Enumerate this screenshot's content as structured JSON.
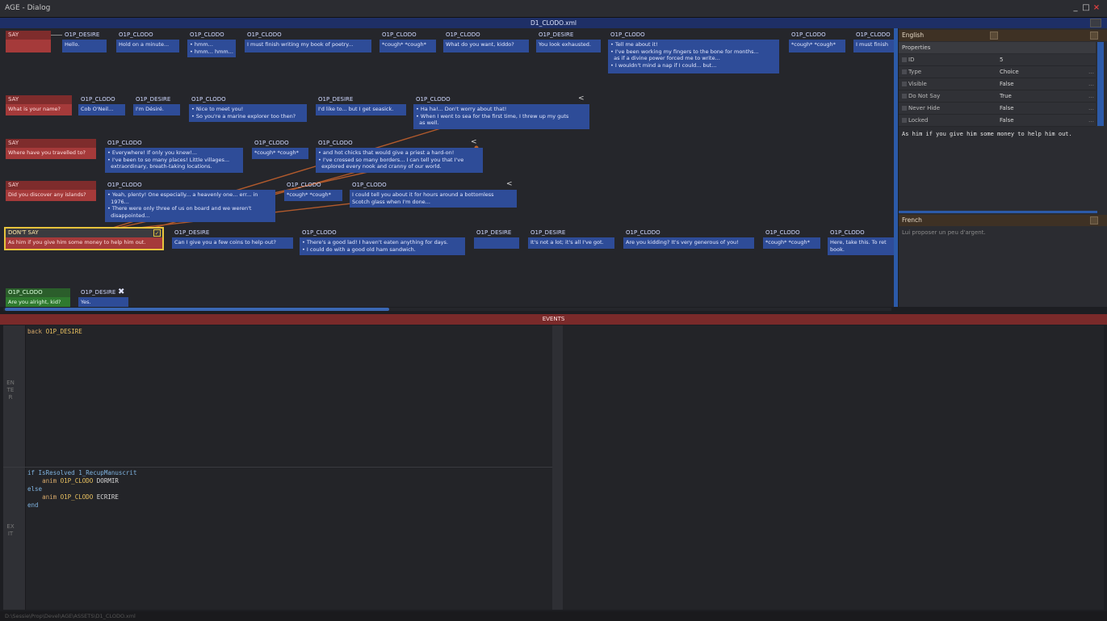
{
  "window": {
    "title": "AGE - Dialog",
    "min": "_",
    "max": "□",
    "close": "×"
  },
  "file": {
    "name": "D1_CLODO.xml"
  },
  "colors": {
    "say": "#a53a3a",
    "npc": "#2e4c98",
    "events": "#7a2a2a",
    "selected": "#e6c33c",
    "green": "#2f7a2f"
  },
  "rows": [
    {
      "say": {
        "head": "SAY",
        "body": ""
      },
      "nodes": [
        {
          "head": "O1P_DESIRE",
          "body": "Hello."
        },
        {
          "head": "O1P_CLODO",
          "body": "Hold on a minute..."
        },
        {
          "head": "O1P_CLODO",
          "body": "• hmm...\n• hmm... hmm..."
        },
        {
          "head": "O1P_CLODO",
          "body": "I must finish writing my book of poetry..."
        },
        {
          "head": "O1P_CLODO",
          "body": "*cough* *cough*"
        },
        {
          "head": "O1P_CLODO",
          "body": "What do you want, kiddo?"
        },
        {
          "head": "O1P_DESIRE",
          "body": "You look exhausted."
        },
        {
          "head": "O1P_CLODO",
          "body": "• Tell me about it!\n• I've been working my fingers to the bone for months...\n  as if a divine power forced me to write...\n• I wouldn't mind a nap if I could... but..."
        },
        {
          "head": "O1P_CLODO",
          "body": "*cough* *cough*"
        },
        {
          "head": "O1P_CLODO",
          "body": "I must finish"
        }
      ]
    },
    {
      "say": {
        "head": "SAY",
        "body": "What is your name?"
      },
      "nodes": [
        {
          "head": "O1P_CLODO",
          "body": "Cob O'Neil..."
        },
        {
          "head": "O1P_DESIRE",
          "body": "I'm Désiré."
        },
        {
          "head": "O1P_CLODO",
          "body": "• Nice to meet you!\n• So you're a marine explorer too then?"
        },
        {
          "head": "O1P_DESIRE",
          "body": "I'd like to... but I get seasick."
        },
        {
          "head": "O1P_CLODO",
          "body": "• Ha ha!... Don't worry about that!\n• When I went to sea for the first time, I threw up my guts\n  as well."
        }
      ]
    },
    {
      "say": {
        "head": "SAY",
        "body": "Where have you travelled to?"
      },
      "nodes": [
        {
          "head": "O1P_CLODO",
          "body": "• Everywhere! If only you knew!...\n• I've been to so many places! Little villages...\n  extraordinary, breath-taking locations."
        },
        {
          "head": "O1P_CLODO",
          "body": "*cough* *cough*"
        },
        {
          "head": "O1P_CLODO",
          "body": "• and hot chicks that would give a priest a hard-on!\n• I've crossed so many borders... I can tell you that I've\n  explored every nook and cranny of our world."
        }
      ]
    },
    {
      "say": {
        "head": "SAY",
        "body": "Did you discover any islands?"
      },
      "nodes": [
        {
          "head": "O1P_CLODO",
          "body": "• Yeah, plenty! One especially... a heavenly one... err... in\n  1976...\n• There were only three of us on board and we weren't\n  disappointed..."
        },
        {
          "head": "O1P_CLODO",
          "body": "*cough* *cough*"
        },
        {
          "head": "O1P_CLODO",
          "body": "I could tell you about it for hours around a bottomless\nScotch glass when I'm done..."
        }
      ]
    },
    {
      "say": {
        "head": "DON'T SAY",
        "body": "As him if you give him some money to help him out."
      },
      "nodes": [
        {
          "head": "O1P_DESIRE",
          "body": "Can I give you a few coins to help out?"
        },
        {
          "head": "O1P_CLODO",
          "body": "• There's a good lad! I haven't eaten anything for days.\n• I could do with a good old ham sandwich."
        },
        {
          "head": "O1P_DESIRE",
          "body": ""
        },
        {
          "head": "O1P_DESIRE",
          "body": "It's not a lot; it's all I've got."
        },
        {
          "head": "O1P_CLODO",
          "body": "Are you kidding? It's very generous of you!"
        },
        {
          "head": "O1P_CLODO",
          "body": "*cough* *cough*"
        },
        {
          "head": "O1P_CLODO",
          "body": "Here, take this. To ret\nbook."
        }
      ]
    },
    {
      "say": {
        "head": "O1P_CLODO",
        "body": "Are you alright, kid?"
      },
      "nodes": [
        {
          "head": "O1P_DESIRE",
          "body": "Yes."
        }
      ]
    }
  ],
  "properties": {
    "lang_top": "English",
    "section": "Properties",
    "rows": [
      {
        "key": "ID",
        "value": "5"
      },
      {
        "key": "Type",
        "value": "Choice"
      },
      {
        "key": "Visible",
        "value": "False"
      },
      {
        "key": "Do Not Say",
        "value": "True"
      },
      {
        "key": "Never Hide",
        "value": "False"
      },
      {
        "key": "Locked",
        "value": "False"
      }
    ],
    "english_text": "As him if you give him some money to help him out.",
    "lang_bottom": "French",
    "french_text": "Lui proposer un peu d'argent."
  },
  "events": {
    "title": "EVENTS",
    "enter_label": "ENTER",
    "exit_label": "EXIT",
    "enter_code": [
      {
        "kw": "back",
        "name": "O1P_DESIRE"
      }
    ],
    "exit_code": {
      "l1": "if IsResolved 1_RecupManuscrit",
      "l2a": "anim",
      "l2b": "O1P_CLODO",
      "l2c": "DORMIR",
      "l3": "else",
      "l4a": "anim",
      "l4b": "O1P_CLODO",
      "l4c": "ECRIRE",
      "l5": "end"
    }
  },
  "status": "D:\\Sessie\\Prop\\Devel\\AGE\\ASSETS\\D1_CLODO.xml"
}
